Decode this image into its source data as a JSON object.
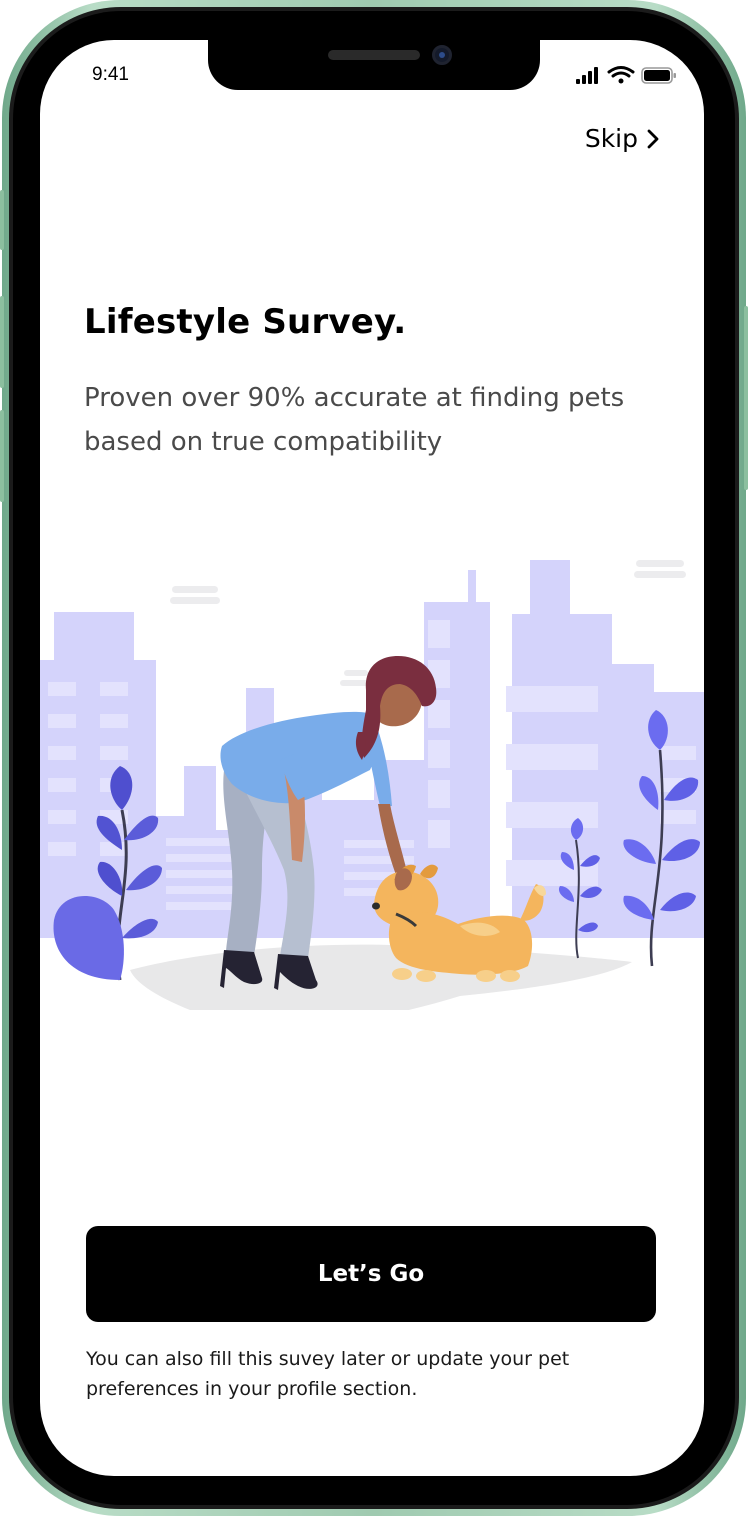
{
  "status_bar": {
    "time": "9:41"
  },
  "header": {
    "skip_label": "Skip"
  },
  "main": {
    "title": "Lifestyle Survey.",
    "subtitle": "Proven over 90% accurate at finding pets based on true compatibility"
  },
  "actions": {
    "primary_label": "Let’s Go"
  },
  "footer": {
    "note": "You can also fill this suvey later or update your pet preferences in your profile section."
  },
  "icons": {
    "status": [
      "signal-icon",
      "wifi-icon",
      "battery-icon"
    ],
    "skip": "chevron-right-icon"
  },
  "colors": {
    "device_frame": "#9fcab0",
    "buildings": "#d4d3fb",
    "plant": "#5b5cd9",
    "button": "#000000",
    "dog": "#f4b55d",
    "shirt": "#79acea"
  }
}
